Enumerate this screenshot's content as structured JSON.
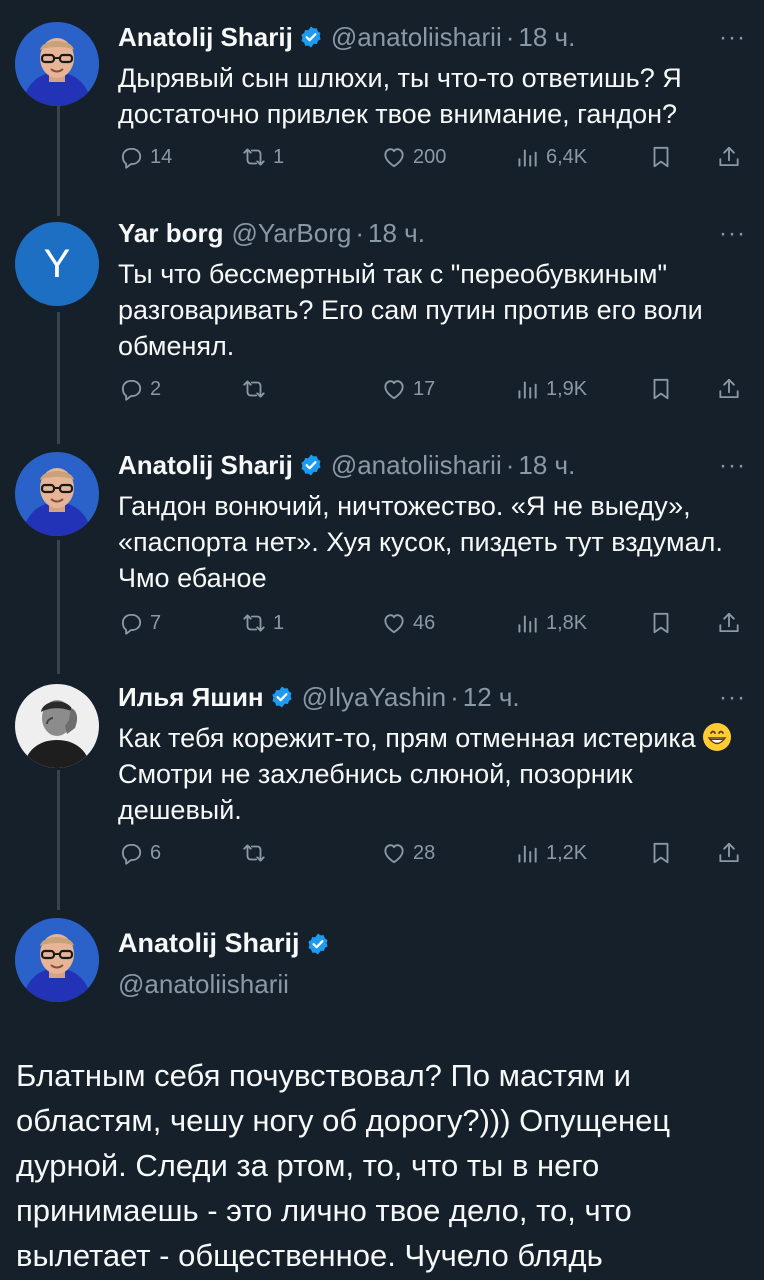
{
  "tweets": [
    {
      "name": "Anatolij Sharij",
      "handle": "@anatoliisharii",
      "dot": "·",
      "time": "18 ч.",
      "verified": true,
      "avatar_icon": "photo-avatar-man-glasses",
      "text": "Дырявый сын шлюхи, ты что-то ответишь? Я достаточно привлек твое внимание, гандон?",
      "replies": "14",
      "reposts": "1",
      "likes": "200",
      "views": "6,4K"
    },
    {
      "name": "Yar borg",
      "handle": "@YarBorg",
      "dot": "·",
      "time": "18 ч.",
      "verified": false,
      "avatar_letter": "Y",
      "avatar_color": "#1d6fc4",
      "text": "Ты что бессмертный так с \"переобувкиным\" разговаривать? Его сам путин против его воли обменял.",
      "replies": "2",
      "reposts": "",
      "likes": "17",
      "views": "1,9K"
    },
    {
      "name": "Anatolij Sharij",
      "handle": "@anatoliisharii",
      "dot": "·",
      "time": "18 ч.",
      "verified": true,
      "avatar_icon": "photo-avatar-man-glasses",
      "text": "Гандон вонючий, ничтожество. «Я не выеду», «паспорта нет». Хуя кусок, пиздеть тут вздумал. Чмо ебаное",
      "replies": "7",
      "reposts": "1",
      "likes": "46",
      "views": "1,8K"
    },
    {
      "name": "Илья Яшин",
      "handle": "@IlyaYashin",
      "dot": "·",
      "time": "12 ч.",
      "verified": true,
      "avatar_icon": "photo-avatar-bw",
      "text_before": "Как тебя корежит-то, прям отменная истерика",
      "emoji": "grinning-face-emoji",
      "text_after": "Смотри не захлебнись слюной, позорник дешевый.",
      "replies": "6",
      "reposts": "",
      "likes": "28",
      "views": "1,2K"
    }
  ],
  "main_tweet": {
    "name": "Anatolij Sharij",
    "handle": "@anatoliisharii",
    "verified": true,
    "text": "Блатным себя почувствовал? По мастям и областям, чешу ногу об дорогу?))) Опущенец дурной. Следи за ртом, то, что ты в него принимаешь - это лично твое дело, то, что вылетает - общественное. Чучело блядь"
  },
  "colors": {
    "background": "#15202b",
    "text": "#f7f9f9",
    "secondary": "#8b98a5",
    "verified": "#1d9bf0",
    "thread_line": "#38444d"
  },
  "more_label": "···"
}
